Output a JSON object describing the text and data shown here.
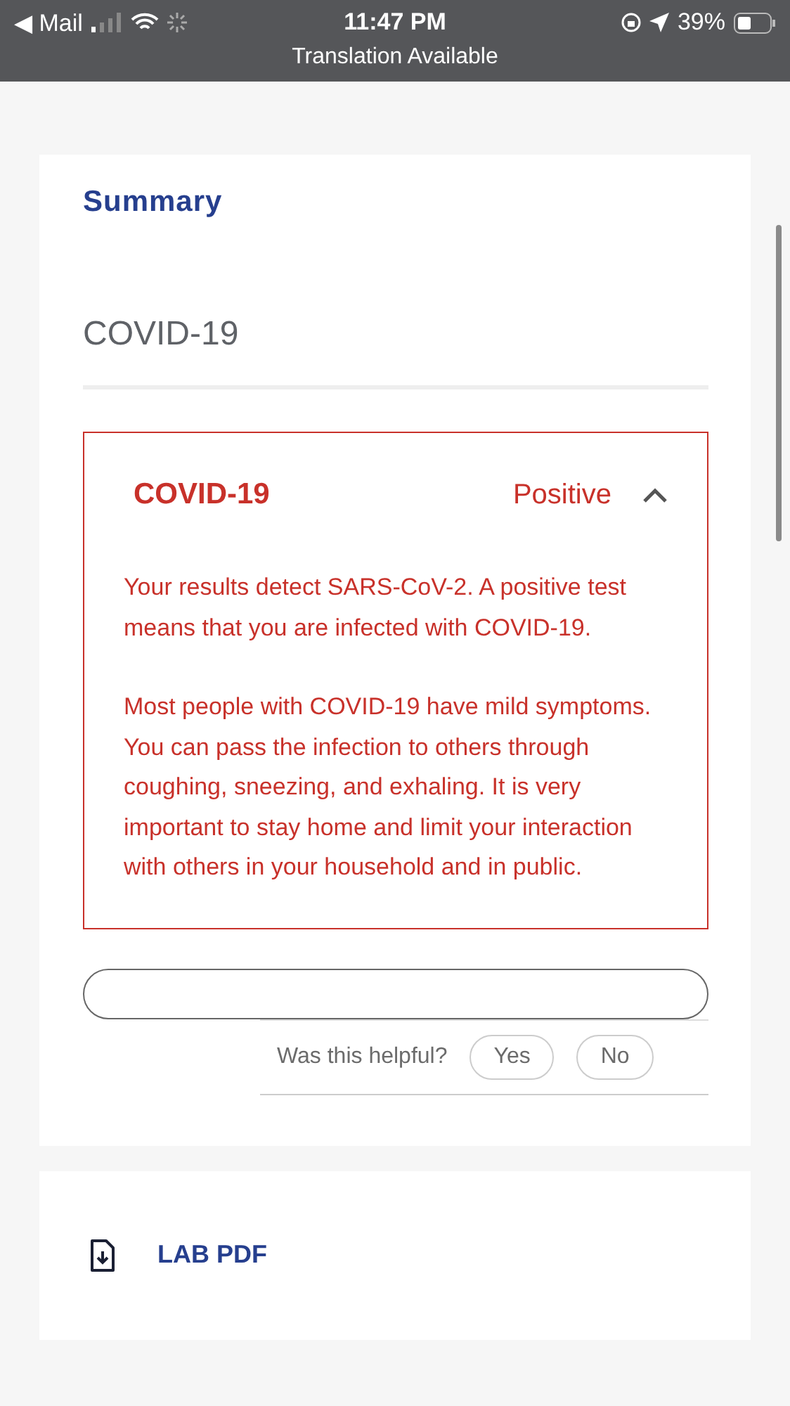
{
  "status_bar": {
    "back_label": "◀ Mail",
    "time": "11:47 PM",
    "battery": "39%",
    "banner": "Translation Available"
  },
  "summary": {
    "title": "Summary",
    "test_name": "COVID-19",
    "result": {
      "name": "COVID-19",
      "value": "Positive",
      "expanded": true,
      "paragraphs": [
        "Your results detect SARS-CoV-2. A positive test means that you are infected with COVID-19.",
        "Most people with COVID-19 have mild symptoms. You can pass the infection to others through coughing, sneezing, and exhaling. It is very important to stay home and limit your interaction with others in your household and in public."
      ]
    },
    "feedback": {
      "question": "Was this helpful?",
      "buttons": [
        "Yes",
        "No"
      ]
    }
  },
  "documents": [
    {
      "label": "LAB PDF"
    }
  ]
}
